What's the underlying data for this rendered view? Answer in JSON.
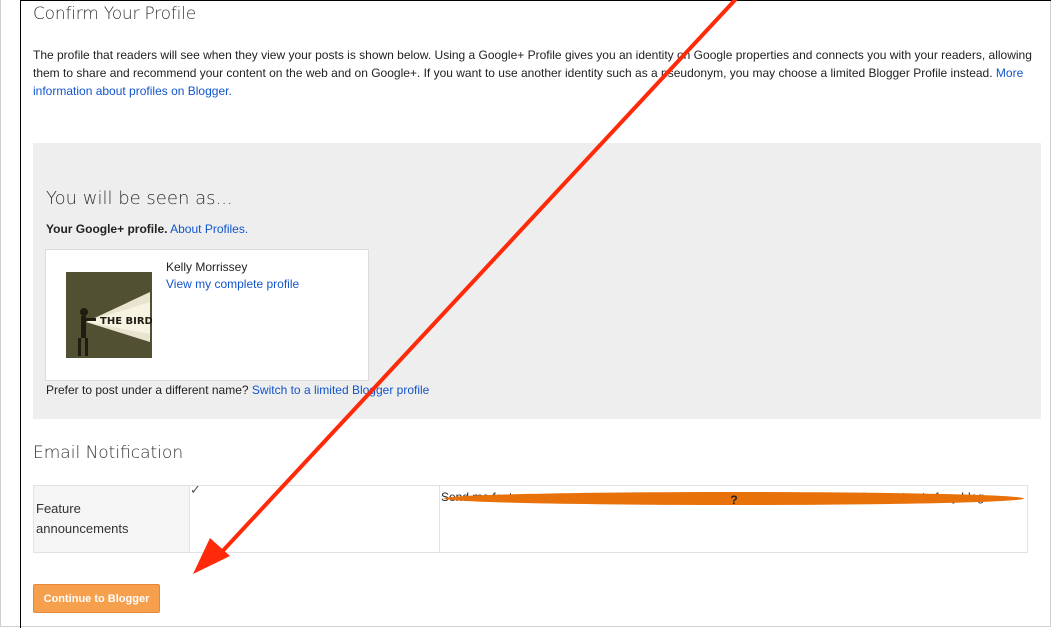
{
  "page": {
    "title": "Confirm Your Profile",
    "intro_text": "The profile that readers will see when they view your posts is shown below. Using a Google+ Profile gives you an identity on Google properties and connects you with your readers, allowing them to share and recommend your content on the web and on Google+. If you want to use another identity such as a pseudonym, you may choose a limited Blogger Profile instead.",
    "intro_link": "More information about profiles on Blogger."
  },
  "profile": {
    "heading": "You will be seen as...",
    "gplus_label": "Your Google+ profile.",
    "about_link": "About Profiles.",
    "name": "Kelly Morrissey",
    "view_link": "View my complete profile",
    "avatar_text": "THE BIRD",
    "prefer_text": "Prefer to post under a different name?",
    "switch_link": "Switch to a limited Blogger profile"
  },
  "email": {
    "heading": "Email Notification",
    "row_label": "Feature announcements",
    "checked": true,
    "checkmark_glyph": "✓",
    "description": "Send me feature announcements, advice and other information to help me get the most out of my blog.",
    "help_glyph": "?"
  },
  "actions": {
    "continue_label": "Continue to Blogger"
  },
  "colors": {
    "link": "#1155cc",
    "button": "#f6a04d",
    "arrow": "#ff2a0a",
    "panel": "#eeeeee"
  }
}
